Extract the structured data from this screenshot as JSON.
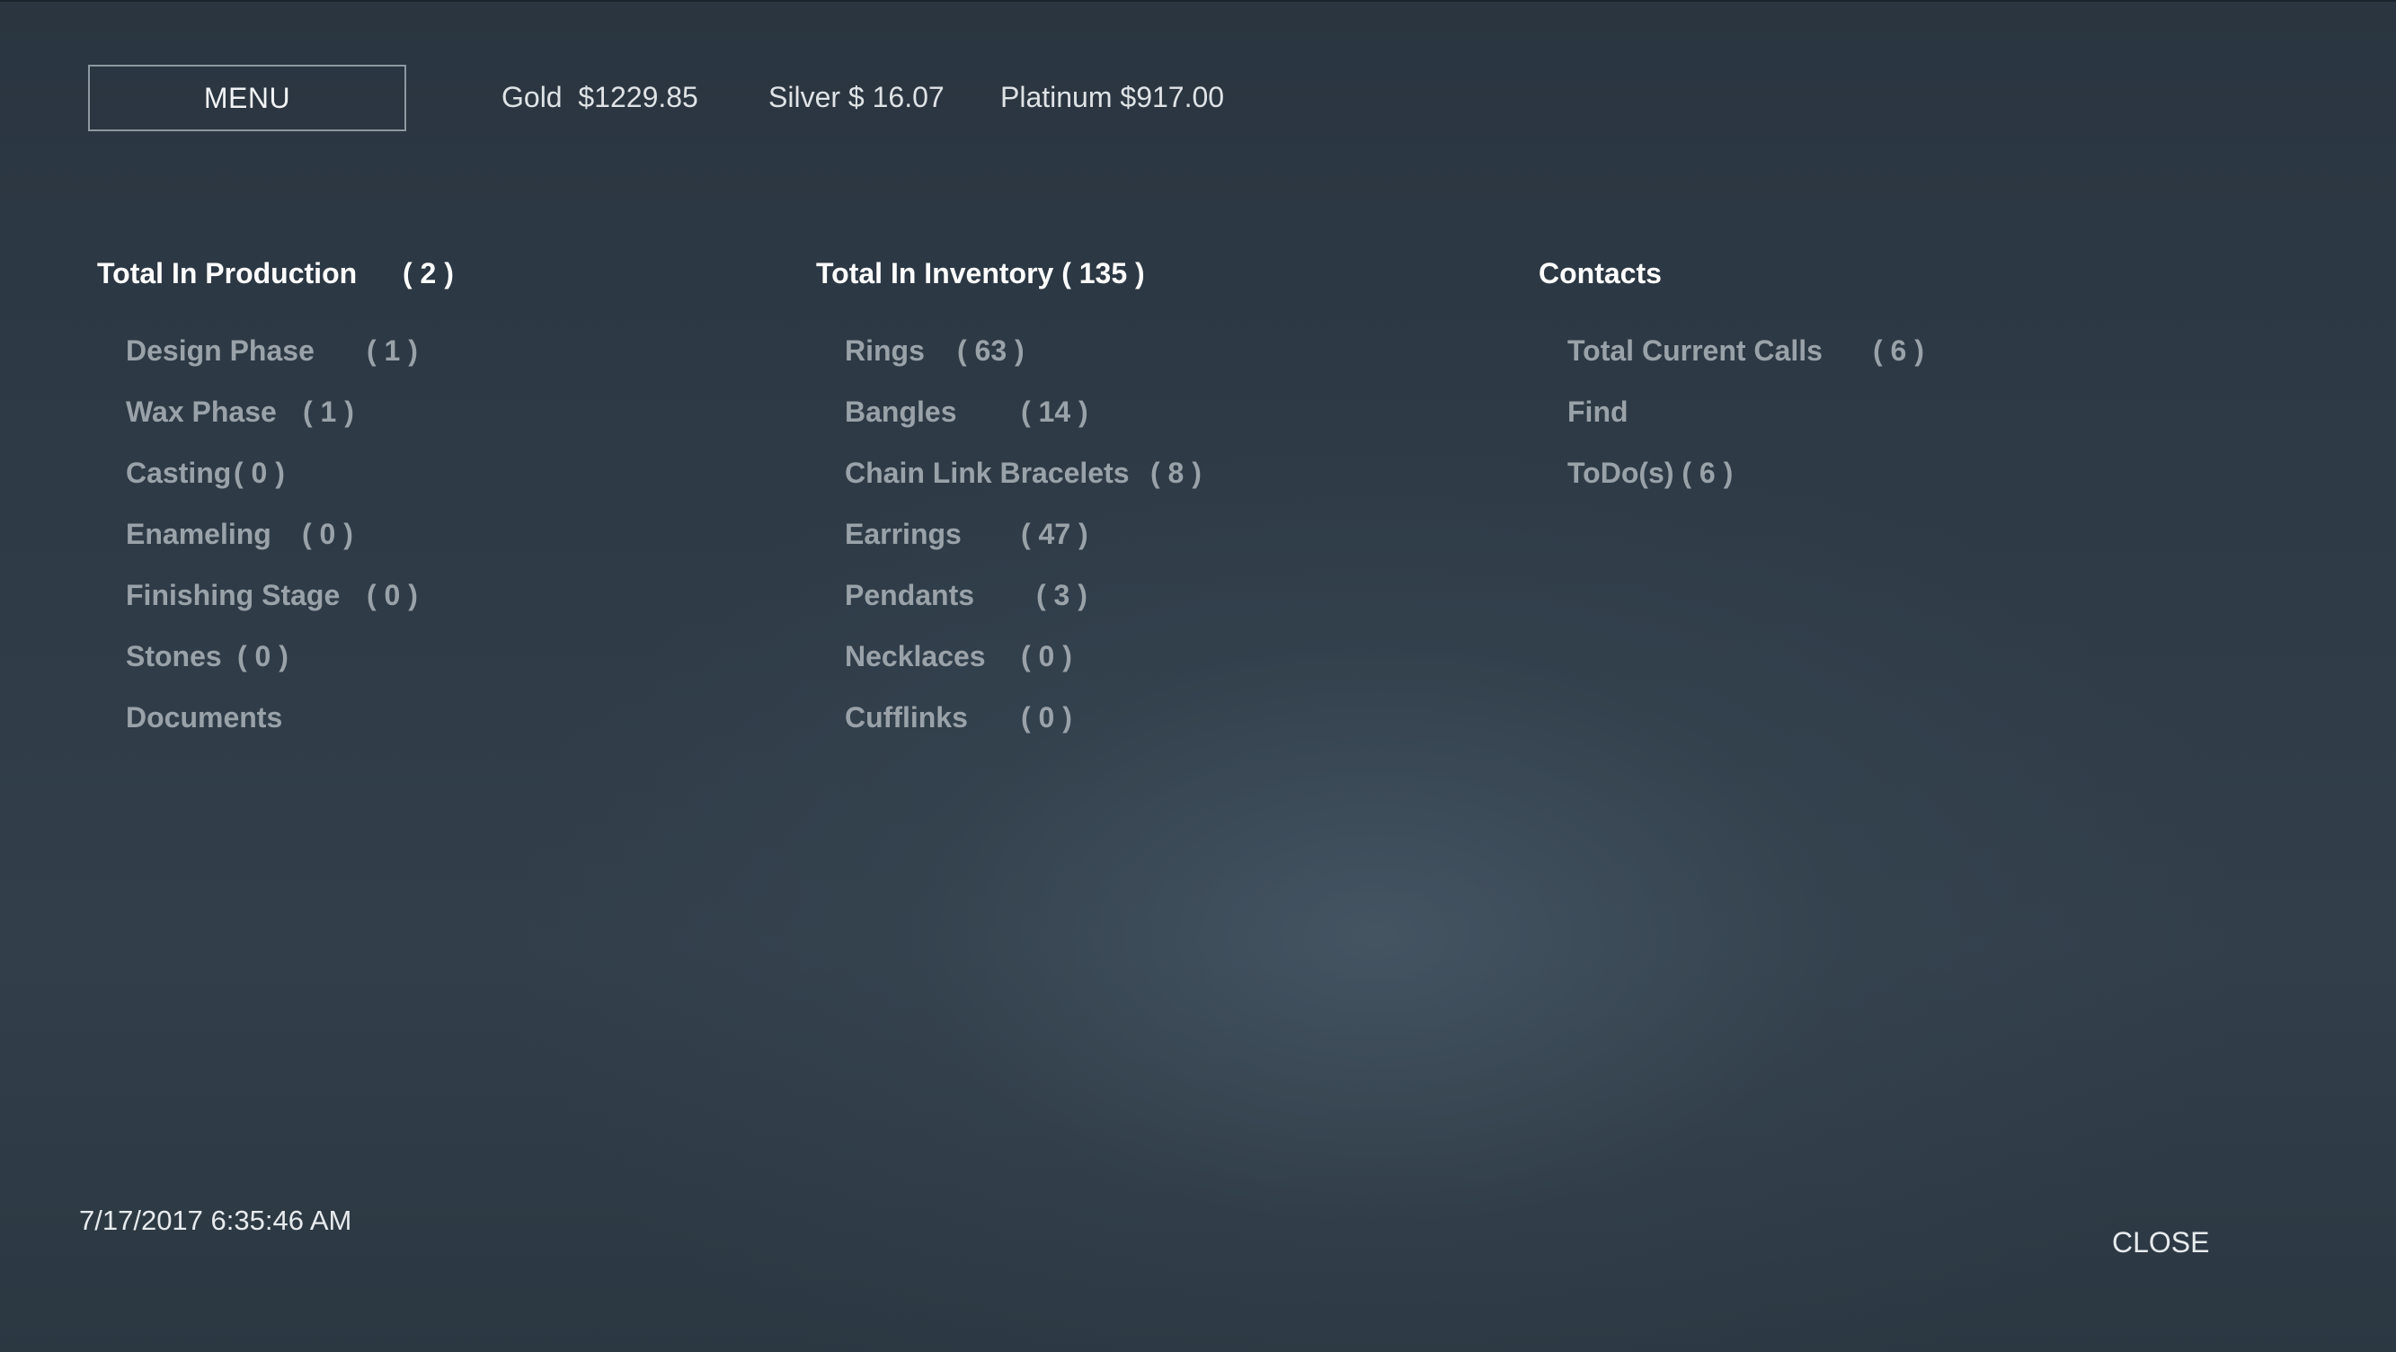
{
  "header": {
    "menu_label": "MENU",
    "gold": "Gold  $1229.85",
    "silver": "Silver $ 16.07",
    "platinum": "Platinum $917.00"
  },
  "production": {
    "title": "Total In Production",
    "total": "( 2 )",
    "items": [
      {
        "label": "Design Phase",
        "count": "( 1 )"
      },
      {
        "label": "Wax Phase",
        "count": "( 1 )"
      },
      {
        "label": "Casting",
        "count": "( 0 )"
      },
      {
        "label": "Enameling",
        "count": "( 0 )"
      },
      {
        "label": "Finishing Stage",
        "count": "( 0 )"
      },
      {
        "label": "Stones",
        "count": "( 0 )"
      },
      {
        "label": "Documents",
        "count": ""
      }
    ]
  },
  "inventory": {
    "title": "Total In Inventory ( 135 )",
    "items": [
      {
        "label": "Rings",
        "count": "( 63 )"
      },
      {
        "label": "Bangles",
        "count": "( 14 )"
      },
      {
        "label": "Chain Link Bracelets",
        "count": "( 8 )"
      },
      {
        "label": "Earrings",
        "count": "( 47 )"
      },
      {
        "label": "Pendants",
        "count": "( 3 )"
      },
      {
        "label": "Necklaces",
        "count": "( 0 )"
      },
      {
        "label": "Cufflinks",
        "count": "( 0 )"
      }
    ]
  },
  "contacts": {
    "title": "Contacts",
    "items": [
      {
        "label": "Total Current Calls",
        "count": "( 6 )"
      },
      {
        "label": "Find",
        "count": ""
      },
      {
        "label": "ToDo(s) ( 6 )",
        "count": ""
      }
    ]
  },
  "footer": {
    "timestamp": "7/17/2017 6:35:46 AM",
    "close_label": "CLOSE"
  },
  "colors": {
    "background": "#2f3c48",
    "title_text": "#ffffff",
    "item_text": "#9aa2a9"
  }
}
